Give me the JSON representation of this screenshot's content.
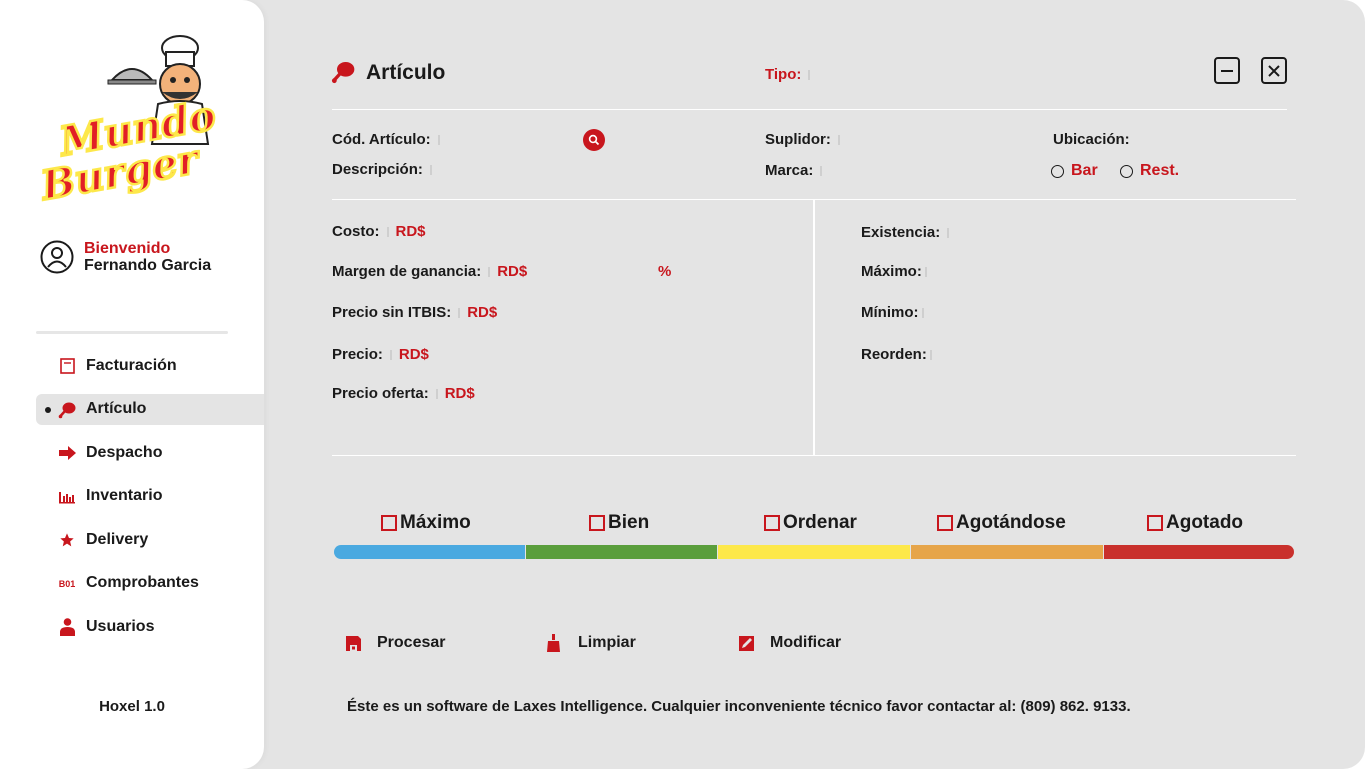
{
  "colors": {
    "accent": "#c8161d",
    "bg": "#e4e4e4",
    "text": "#1a1a1a"
  },
  "logo": {
    "line1": "Mundo",
    "line2": "Burger"
  },
  "user": {
    "greeting": "Bienvenido",
    "name": "Fernando Garcia"
  },
  "nav": [
    {
      "label": "Facturación",
      "icon": "receipt-icon"
    },
    {
      "label": "Artículo",
      "icon": "drumstick-icon",
      "active": true
    },
    {
      "label": "Despacho",
      "icon": "arrow-right-icon"
    },
    {
      "label": "Inventario",
      "icon": "bar-chart-icon"
    },
    {
      "label": "Delivery",
      "icon": "star-icon"
    },
    {
      "label": "Comprobantes",
      "icon": "b01-icon",
      "icon_text": "B01"
    },
    {
      "label": "Usuarios",
      "icon": "user-icon"
    }
  ],
  "version": "Hoxel 1.0",
  "header": {
    "title": "Artículo",
    "tipo_label": "Tipo:"
  },
  "form": {
    "cod_articulo": "Cód. Artículo:",
    "descripcion": "Descripción:",
    "suplidor": "Suplidor:",
    "marca": "Marca:",
    "ubicacion": "Ubicación:",
    "radio_bar": "Bar",
    "radio_rest": "Rest."
  },
  "pricing": {
    "costo": "Costo:",
    "margen": "Margen de ganancia:",
    "precio_sin_itbis": "Precio sin ITBIS:",
    "precio": "Precio:",
    "precio_oferta": "Precio oferta:",
    "currency": "RD$",
    "percent": "%"
  },
  "stock": {
    "existencia": "Existencia:",
    "maximo": "Máximo:",
    "minimo": "Mínimo:",
    "reorden": "Reorden:"
  },
  "status": [
    {
      "label": "Máximo",
      "color": "#4aa9e0"
    },
    {
      "label": "Bien",
      "color": "#5a9e3c"
    },
    {
      "label": "Ordenar",
      "color": "#fde84a"
    },
    {
      "label": "Agotándose",
      "color": "#e6a54a"
    },
    {
      "label": "Agotado",
      "color": "#c9302c"
    }
  ],
  "actions": {
    "procesar": "Procesar",
    "limpiar": "Limpiar",
    "modificar": "Modificar"
  },
  "footer": "Éste es un software de Laxes Intelligence. Cualquier inconveniente técnico favor contactar al:  (809) 862. 9133."
}
